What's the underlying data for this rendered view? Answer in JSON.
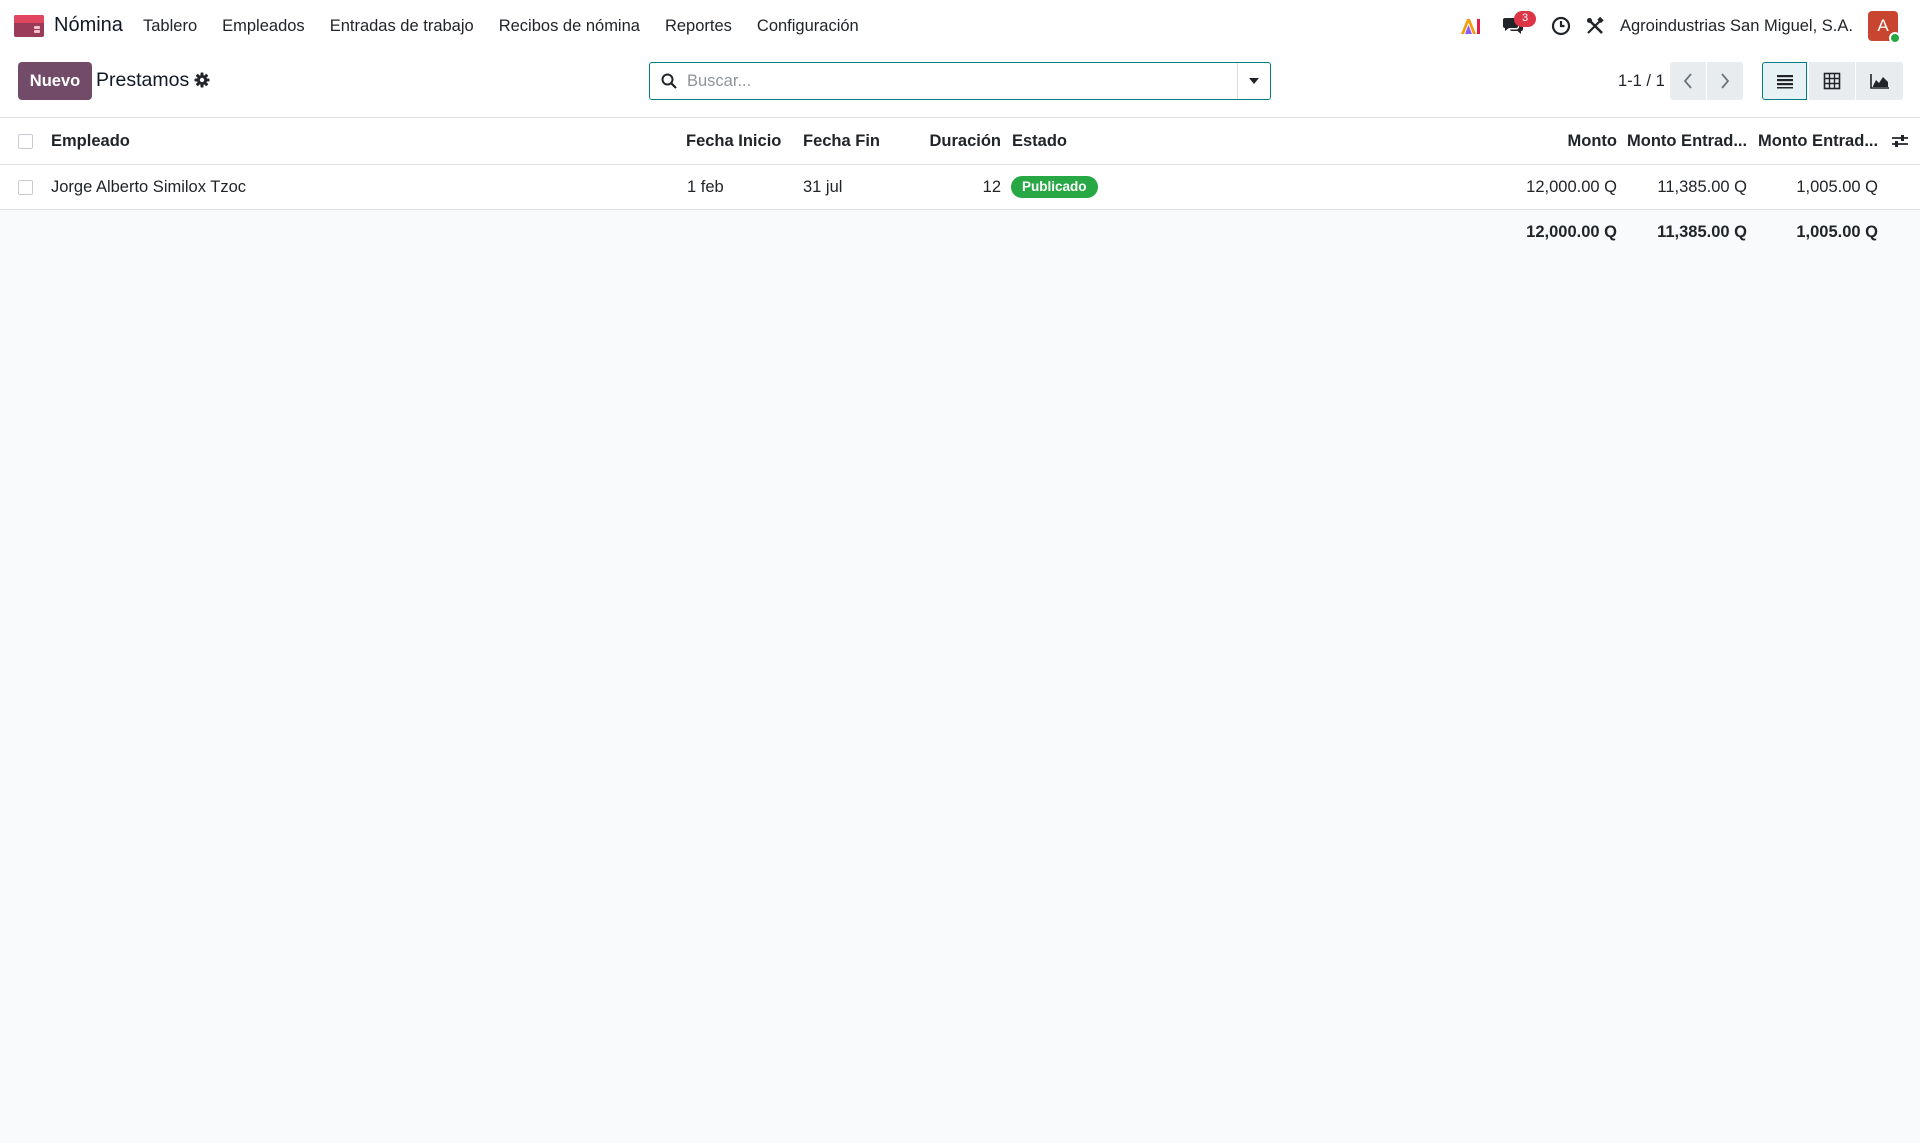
{
  "app": {
    "name": "Nómina",
    "menu": [
      "Tablero",
      "Empleados",
      "Entradas de trabajo",
      "Recibos de nómina",
      "Reportes",
      "Configuración"
    ]
  },
  "systray": {
    "messages_count": "3",
    "company": "Agroindustrias San Miguel, S.A.",
    "avatar_letter": "A"
  },
  "control": {
    "new_button": "Nuevo",
    "page_title": "Prestamos",
    "search_placeholder": "Buscar...",
    "pager": "1-1 / 1"
  },
  "table": {
    "headers": {
      "employee": "Empleado",
      "start": "Fecha Inicio",
      "end": "Fecha Fin",
      "duration": "Duración",
      "status": "Estado",
      "amount": "Monto",
      "amount_entry": "Monto Entrad...",
      "amount_entry2": "Monto Entrad..."
    },
    "rows": [
      {
        "employee": "Jorge Alberto Similox Tzoc",
        "start": "1 feb",
        "end": "31 jul",
        "duration": "12",
        "status": "Publicado",
        "amount": "12,000.00 Q",
        "amount_entry": "11,385.00 Q",
        "amount_entry2": "1,005.00 Q"
      }
    ],
    "totals": {
      "amount": "12,000.00 Q",
      "amount_entry": "11,385.00 Q",
      "amount_entry2": "1,005.00 Q"
    }
  },
  "colors": {
    "brand": "#714b67",
    "accent": "#017e84",
    "status_success": "#28a745",
    "badge": "#dc3545"
  }
}
